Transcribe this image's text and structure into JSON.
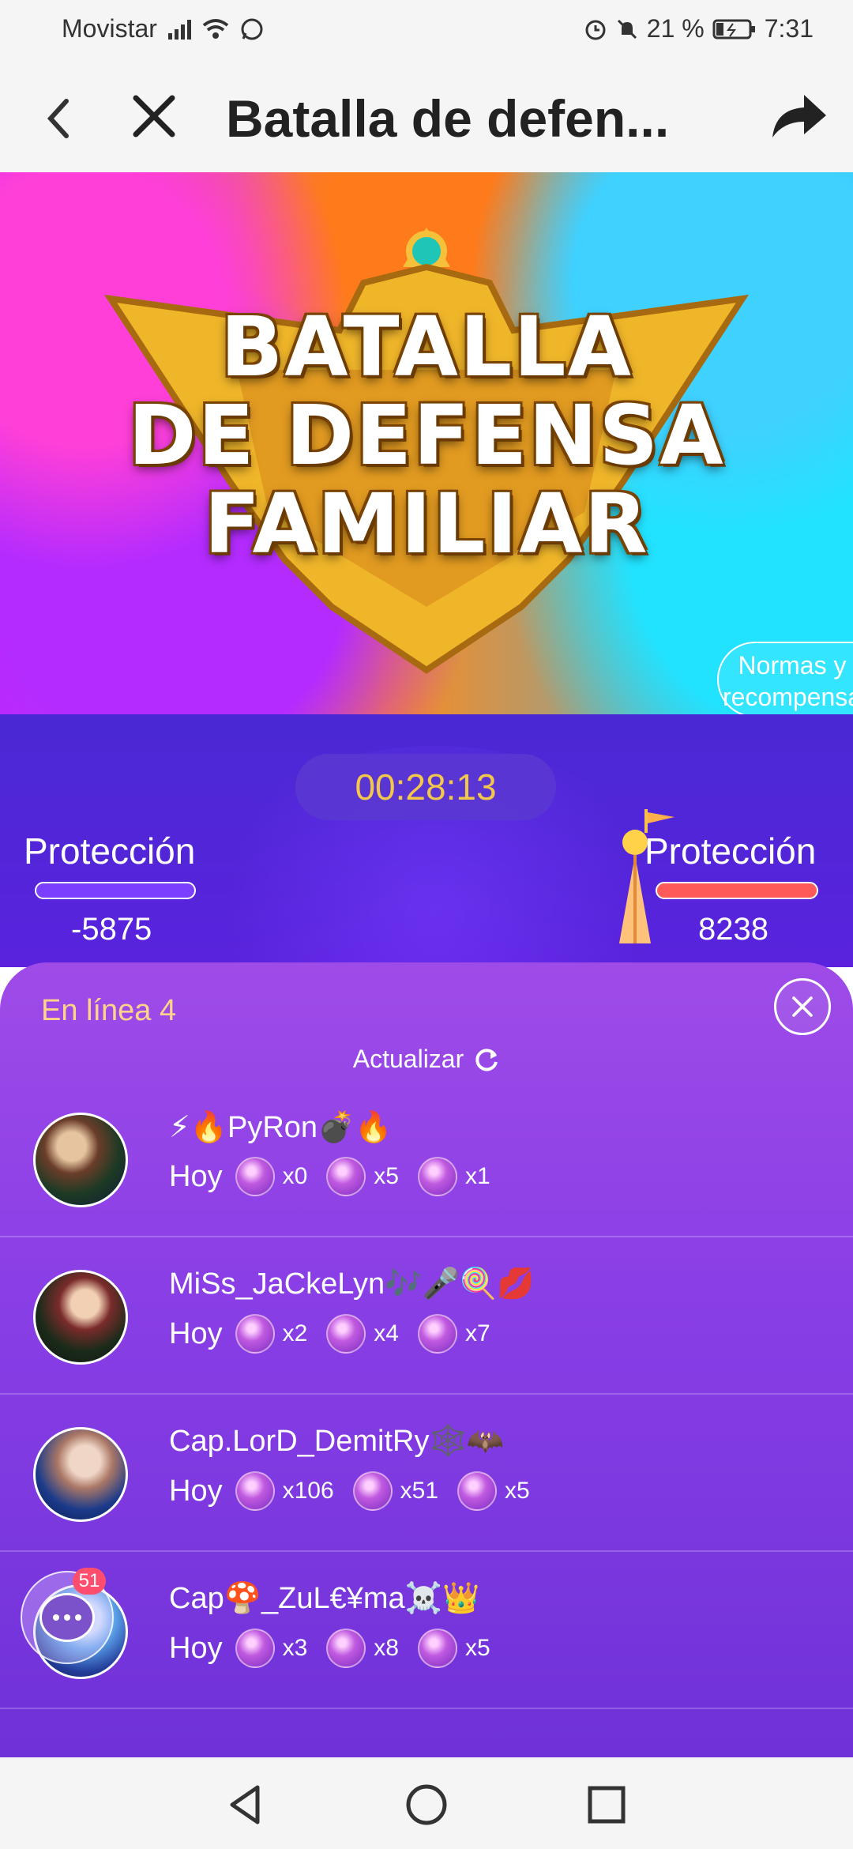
{
  "status_bar": {
    "carrier": "Movistar",
    "battery": "21 %",
    "time": "7:31"
  },
  "app_bar": {
    "title": "Batalla de defen..."
  },
  "banner": {
    "title_lines": [
      "BATALLA",
      "DE DEFENSA",
      "FAMILIAR"
    ],
    "rules_button": "Normas y recompensa"
  },
  "battle": {
    "timer": "00:28:13",
    "left": {
      "label": "Protección",
      "score": "-5875",
      "bar_color": "#7b3fff"
    },
    "right": {
      "label": "Protección",
      "score": "8238",
      "bar_color": "#ff5a5a"
    }
  },
  "sheet": {
    "online_label": "En línea 4",
    "refresh_label": "Actualizar",
    "users": [
      {
        "name": "⚡🔥PyRon💣🔥",
        "day": "Hoy",
        "counts": [
          "x0",
          "x5",
          "x1"
        ]
      },
      {
        "name": "MiSs_JaCkeLyn🎶🎤🍭💋",
        "day": "Hoy",
        "counts": [
          "x2",
          "x4",
          "x7"
        ]
      },
      {
        "name": "Cap.LorD_DemitRy🕸️🦇",
        "day": "Hoy",
        "counts": [
          "x106",
          "x51",
          "x5"
        ]
      },
      {
        "name": "Cap🍄_ZuL€¥ma☠️👑",
        "day": "Hoy",
        "counts": [
          "x3",
          "x8",
          "x5"
        ]
      }
    ],
    "chat_badge": "51"
  }
}
